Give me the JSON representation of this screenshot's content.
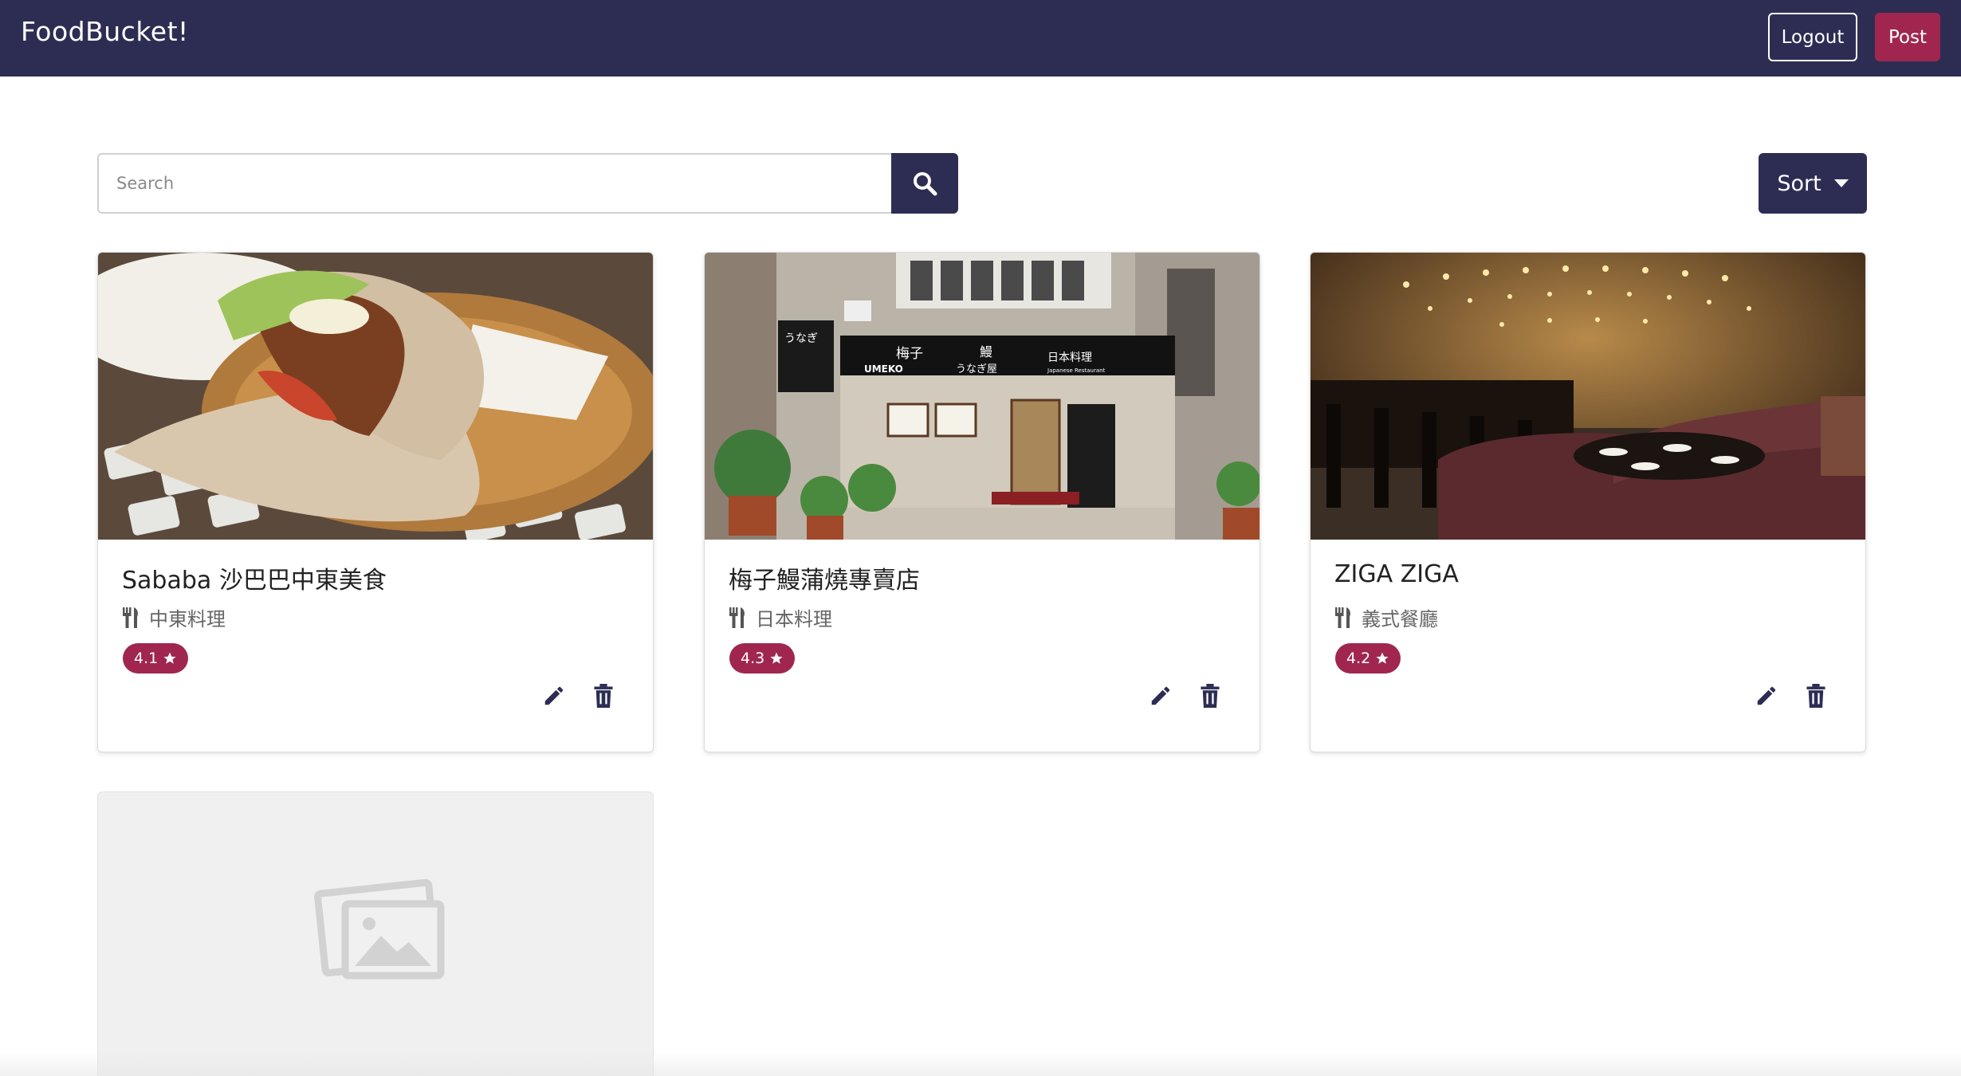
{
  "app": {
    "brand": "FoodBucket!"
  },
  "navbar": {
    "logout_label": "Logout",
    "post_label": "Post"
  },
  "search": {
    "placeholder": "Search",
    "value": ""
  },
  "sort": {
    "label": "Sort"
  },
  "colors": {
    "navy": "#2d2d54",
    "accent": "#a02650"
  },
  "restaurants": [
    {
      "name": "Sababa 沙巴巴中東美食",
      "cuisine": "中東料理",
      "rating": "4.1",
      "image": "pita-sandwich-photo"
    },
    {
      "name": "梅子鰻蒲燒專賣店",
      "cuisine": "日本料理",
      "rating": "4.3",
      "image": "storefront-photo",
      "sign": {
        "main": "梅子",
        "romaji": "UMEKO",
        "eel": "鰻",
        "kana": "うなぎ屋",
        "jp": "日本料理",
        "en": "Japanese Restaurant",
        "left": "うなぎ"
      }
    },
    {
      "name": "ZIGA ZIGA",
      "cuisine": "義式餐廳",
      "rating": "4.2",
      "image": "dining-room-photo"
    },
    {
      "name": "",
      "cuisine": "",
      "rating": "",
      "image": "placeholder-image-icon"
    }
  ]
}
